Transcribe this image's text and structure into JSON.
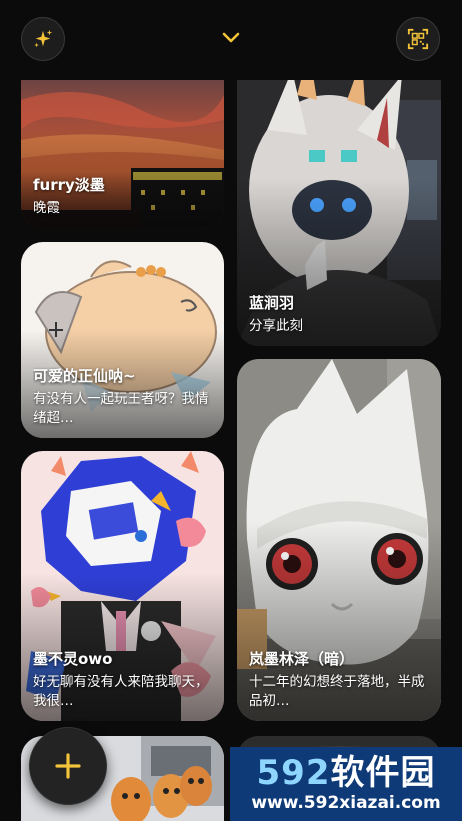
{
  "header": {
    "left_icon": "sparkle-icon",
    "center_icon": "chevron-down-icon",
    "right_icon": "qr-scan-icon",
    "accent_color": "#f3c33a"
  },
  "feed": {
    "cards": [
      {
        "title": "furry淡墨",
        "subtitle": "晚霞"
      },
      {
        "title": "蓝涧羽",
        "subtitle": "分享此刻"
      },
      {
        "title": "可爱的正仙呐~",
        "subtitle": "有没有人一起玩王者呀？我情绪超…"
      },
      {
        "title": "岚墨林泽（暗）",
        "subtitle": "十二年的幻想终于落地，半成品初…"
      },
      {
        "title": "墨不灵owo",
        "subtitle": "好无聊有没有人来陪我聊天，我很…"
      },
      {
        "title": "",
        "subtitle": ""
      },
      {
        "title": "",
        "subtitle": ""
      }
    ]
  },
  "fab": {
    "icon": "plus-icon",
    "label": "+"
  },
  "watermark": {
    "logo_num": "592",
    "logo_text": "软件园",
    "url": "www.592xiazai.com"
  }
}
